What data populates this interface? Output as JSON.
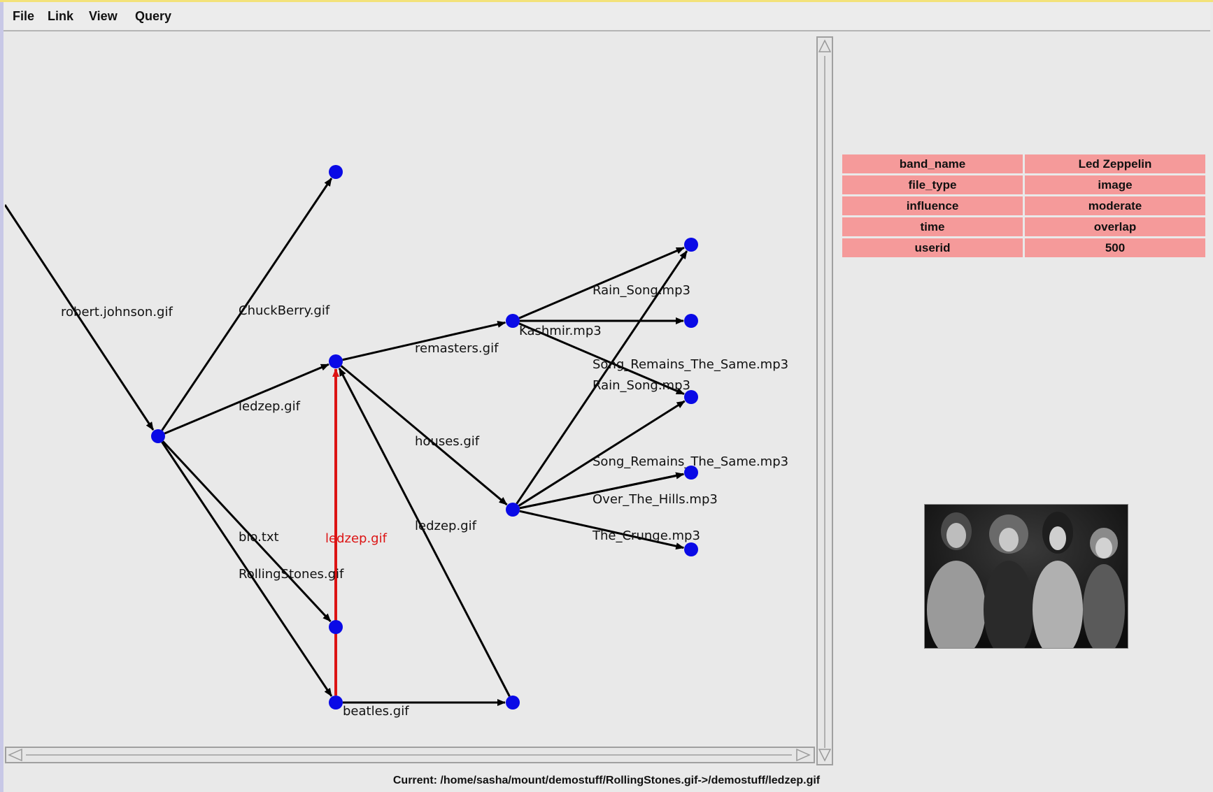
{
  "menu": [
    "File",
    "Link",
    "View",
    "Query"
  ],
  "graph": {
    "nodes": [
      {
        "id": "n_chuck_target"
      },
      {
        "id": "n_hub"
      },
      {
        "id": "n_ledzep"
      },
      {
        "id": "n_kashmir_src"
      },
      {
        "id": "n_houses_src"
      },
      {
        "id": "n_rain1"
      },
      {
        "id": "n_kashmir_tgt"
      },
      {
        "id": "n_songremains_tgt"
      },
      {
        "id": "n_songremains2_tgt"
      },
      {
        "id": "n_crunge_tgt"
      },
      {
        "id": "n_bio"
      },
      {
        "id": "n_beatles"
      },
      {
        "id": "n_beatles_tgt"
      }
    ],
    "edges": [
      {
        "from": "n_hub",
        "to": "n_chuck_target",
        "label": "ChuckBerry.gif"
      },
      {
        "from": "n_hub",
        "to": "n_ledzep",
        "label": "ledzep.gif"
      },
      {
        "from": "n_hub",
        "to": "n_bio",
        "label": "bio.txt"
      },
      {
        "from": "n_hub",
        "to": "n_beatles",
        "label": "RollingStones.gif"
      },
      {
        "from": "n_beatles",
        "to": "n_ledzep",
        "label": "ledzep.gif",
        "highlight": true
      },
      {
        "from": "n_beatles",
        "to": "n_beatles_tgt",
        "label": "beatles.gif"
      },
      {
        "from": "n_beatles_tgt",
        "to": "n_ledzep",
        "label": "ledzep.gif"
      },
      {
        "from": "n_ledzep",
        "to": "n_kashmir_src",
        "label": "remasters.gif"
      },
      {
        "from": "n_ledzep",
        "to": "n_houses_src",
        "label": "houses.gif"
      },
      {
        "from": "n_kashmir_src",
        "to": "n_rain1",
        "label": "Rain_Song.mp3"
      },
      {
        "from": "n_kashmir_src",
        "to": "n_kashmir_tgt",
        "label": "Kashmir.mp3"
      },
      {
        "from": "n_kashmir_src",
        "to": "n_songremains_tgt",
        "label": "Song_Remains_The_Same.mp3"
      },
      {
        "from": "n_houses_src",
        "to": "n_songremains_tgt",
        "label": "Rain_Song.mp3"
      },
      {
        "from": "n_houses_src",
        "to": "n_rain1",
        "label": ""
      },
      {
        "from": "n_houses_src",
        "to": "n_songremains2_tgt",
        "label": "Song_Remains_The_Same.mp3"
      },
      {
        "from": "n_houses_src",
        "to": "n_songremains2_tgt",
        "label": "Over_The_Hills.mp3"
      },
      {
        "from": "n_houses_src",
        "to": "n_crunge_tgt",
        "label": "The_Crunge.mp3"
      }
    ],
    "incoming_label": "robert.johnson.gif",
    "colors": {
      "node": "#0a0ae6",
      "edge": "#000000",
      "highlight": "#dc1414"
    }
  },
  "attributes": [
    {
      "key": "band_name",
      "value": "Led Zeppelin"
    },
    {
      "key": "file_type",
      "value": "image"
    },
    {
      "key": "influence",
      "value": "moderate"
    },
    {
      "key": "time",
      "value": "overlap"
    },
    {
      "key": "userid",
      "value": "500"
    }
  ],
  "status": "Current: /home/sasha/mount/demostuff/RollingStones.gif->/demostuff/ledzep.gif"
}
